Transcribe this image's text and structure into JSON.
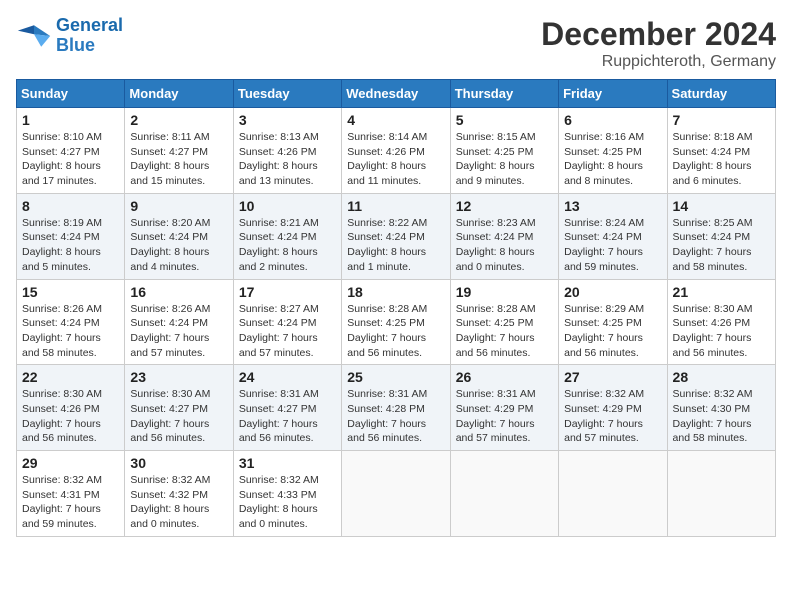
{
  "header": {
    "logo_text_general": "General",
    "logo_text_blue": "Blue",
    "month": "December 2024",
    "location": "Ruppichteroth, Germany"
  },
  "weekdays": [
    "Sunday",
    "Monday",
    "Tuesday",
    "Wednesday",
    "Thursday",
    "Friday",
    "Saturday"
  ],
  "weeks": [
    [
      {
        "day": 1,
        "sunrise": "8:10 AM",
        "sunset": "4:27 PM",
        "daylight": "8 hours and 17 minutes."
      },
      {
        "day": 2,
        "sunrise": "8:11 AM",
        "sunset": "4:27 PM",
        "daylight": "8 hours and 15 minutes."
      },
      {
        "day": 3,
        "sunrise": "8:13 AM",
        "sunset": "4:26 PM",
        "daylight": "8 hours and 13 minutes."
      },
      {
        "day": 4,
        "sunrise": "8:14 AM",
        "sunset": "4:26 PM",
        "daylight": "8 hours and 11 minutes."
      },
      {
        "day": 5,
        "sunrise": "8:15 AM",
        "sunset": "4:25 PM",
        "daylight": "8 hours and 9 minutes."
      },
      {
        "day": 6,
        "sunrise": "8:16 AM",
        "sunset": "4:25 PM",
        "daylight": "8 hours and 8 minutes."
      },
      {
        "day": 7,
        "sunrise": "8:18 AM",
        "sunset": "4:24 PM",
        "daylight": "8 hours and 6 minutes."
      }
    ],
    [
      {
        "day": 8,
        "sunrise": "8:19 AM",
        "sunset": "4:24 PM",
        "daylight": "8 hours and 5 minutes."
      },
      {
        "day": 9,
        "sunrise": "8:20 AM",
        "sunset": "4:24 PM",
        "daylight": "8 hours and 4 minutes."
      },
      {
        "day": 10,
        "sunrise": "8:21 AM",
        "sunset": "4:24 PM",
        "daylight": "8 hours and 2 minutes."
      },
      {
        "day": 11,
        "sunrise": "8:22 AM",
        "sunset": "4:24 PM",
        "daylight": "8 hours and 1 minute."
      },
      {
        "day": 12,
        "sunrise": "8:23 AM",
        "sunset": "4:24 PM",
        "daylight": "8 hours and 0 minutes."
      },
      {
        "day": 13,
        "sunrise": "8:24 AM",
        "sunset": "4:24 PM",
        "daylight": "7 hours and 59 minutes."
      },
      {
        "day": 14,
        "sunrise": "8:25 AM",
        "sunset": "4:24 PM",
        "daylight": "7 hours and 58 minutes."
      }
    ],
    [
      {
        "day": 15,
        "sunrise": "8:26 AM",
        "sunset": "4:24 PM",
        "daylight": "7 hours and 58 minutes."
      },
      {
        "day": 16,
        "sunrise": "8:26 AM",
        "sunset": "4:24 PM",
        "daylight": "7 hours and 57 minutes."
      },
      {
        "day": 17,
        "sunrise": "8:27 AM",
        "sunset": "4:24 PM",
        "daylight": "7 hours and 57 minutes."
      },
      {
        "day": 18,
        "sunrise": "8:28 AM",
        "sunset": "4:25 PM",
        "daylight": "7 hours and 56 minutes."
      },
      {
        "day": 19,
        "sunrise": "8:28 AM",
        "sunset": "4:25 PM",
        "daylight": "7 hours and 56 minutes."
      },
      {
        "day": 20,
        "sunrise": "8:29 AM",
        "sunset": "4:25 PM",
        "daylight": "7 hours and 56 minutes."
      },
      {
        "day": 21,
        "sunrise": "8:30 AM",
        "sunset": "4:26 PM",
        "daylight": "7 hours and 56 minutes."
      }
    ],
    [
      {
        "day": 22,
        "sunrise": "8:30 AM",
        "sunset": "4:26 PM",
        "daylight": "7 hours and 56 minutes."
      },
      {
        "day": 23,
        "sunrise": "8:30 AM",
        "sunset": "4:27 PM",
        "daylight": "7 hours and 56 minutes."
      },
      {
        "day": 24,
        "sunrise": "8:31 AM",
        "sunset": "4:27 PM",
        "daylight": "7 hours and 56 minutes."
      },
      {
        "day": 25,
        "sunrise": "8:31 AM",
        "sunset": "4:28 PM",
        "daylight": "7 hours and 56 minutes."
      },
      {
        "day": 26,
        "sunrise": "8:31 AM",
        "sunset": "4:29 PM",
        "daylight": "7 hours and 57 minutes."
      },
      {
        "day": 27,
        "sunrise": "8:32 AM",
        "sunset": "4:29 PM",
        "daylight": "7 hours and 57 minutes."
      },
      {
        "day": 28,
        "sunrise": "8:32 AM",
        "sunset": "4:30 PM",
        "daylight": "7 hours and 58 minutes."
      }
    ],
    [
      {
        "day": 29,
        "sunrise": "8:32 AM",
        "sunset": "4:31 PM",
        "daylight": "7 hours and 59 minutes."
      },
      {
        "day": 30,
        "sunrise": "8:32 AM",
        "sunset": "4:32 PM",
        "daylight": "8 hours and 0 minutes."
      },
      {
        "day": 31,
        "sunrise": "8:32 AM",
        "sunset": "4:33 PM",
        "daylight": "8 hours and 0 minutes."
      },
      null,
      null,
      null,
      null
    ]
  ]
}
